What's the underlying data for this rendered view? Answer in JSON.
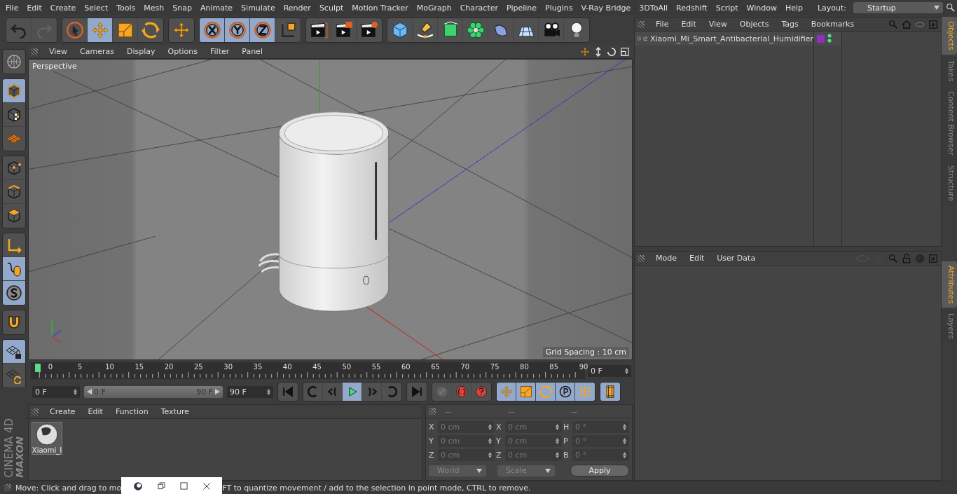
{
  "menu_bar": {
    "items": [
      "File",
      "Edit",
      "Create",
      "Select",
      "Tools",
      "Mesh",
      "Snap",
      "Animate",
      "Simulate",
      "Render",
      "Sculpt",
      "Motion Tracker",
      "MoGraph",
      "Character",
      "Pipeline",
      "Plugins",
      "V-Ray Bridge",
      "3DToAll",
      "Redshift",
      "Script",
      "Window",
      "Help"
    ],
    "layout_label": "Layout:",
    "layout_value": "Startup"
  },
  "main_toolbar": [
    {
      "tools": [
        {
          "selected": false,
          "disabled": false
        },
        {
          "selected": false,
          "disabled": true
        }
      ]
    },
    {
      "tools": [
        {
          "selected": false,
          "disabled": false
        },
        {
          "selected": true,
          "disabled": false
        },
        {
          "selected": false,
          "disabled": false
        },
        {
          "selected": false,
          "disabled": false
        }
      ]
    },
    {
      "tools": [
        {
          "selected": false,
          "disabled": false
        }
      ]
    },
    {
      "tools": [
        {
          "selected": true,
          "disabled": false
        },
        {
          "selected": true,
          "disabled": false
        },
        {
          "selected": true,
          "disabled": false
        },
        {
          "selected": false,
          "disabled": false
        }
      ]
    },
    {
      "tools": [
        {
          "selected": false,
          "disabled": false
        },
        {
          "selected": false,
          "disabled": false
        },
        {
          "selected": false,
          "disabled": false
        }
      ]
    },
    {
      "tools": [
        {
          "selected": false,
          "disabled": false
        },
        {
          "selected": false,
          "disabled": false
        },
        {
          "selected": false,
          "disabled": false
        },
        {
          "selected": false,
          "disabled": false
        },
        {
          "selected": false,
          "disabled": false
        },
        {
          "selected": false,
          "disabled": false
        },
        {
          "selected": false,
          "disabled": false
        },
        {
          "selected": false,
          "disabled": false
        }
      ]
    }
  ],
  "left_toolbar": [
    {
      "tools": [
        {
          "selected": false
        }
      ]
    },
    {
      "tools": [
        {
          "selected": true
        },
        {
          "selected": false
        },
        {
          "selected": false
        }
      ]
    },
    {
      "tools": [
        {
          "selected": false
        },
        {
          "selected": false
        },
        {
          "selected": false
        }
      ]
    },
    {
      "tools": [
        {
          "selected": false
        },
        {
          "selected": true
        },
        {
          "selected": true
        }
      ]
    },
    {
      "tools": [
        {
          "selected": false
        }
      ]
    },
    {
      "tools": [
        {
          "selected": true
        },
        {
          "selected": false
        }
      ]
    }
  ],
  "logo": {
    "brand": "MAXON",
    "product": "CINEMA 4D"
  },
  "viewport": {
    "menu": [
      "View",
      "Cameras",
      "Display",
      "Options",
      "Filter",
      "Panel"
    ],
    "camera": "Perspective",
    "grid_spacing": "Grid Spacing : 10 cm"
  },
  "timeline": {
    "labels": [
      "0",
      "5",
      "10",
      "15",
      "20",
      "25",
      "30",
      "35",
      "40",
      "45",
      "50",
      "55",
      "60",
      "65",
      "70",
      "75",
      "80",
      "85",
      "90"
    ],
    "current_frame": "0 F"
  },
  "playback": {
    "start": "0 F",
    "range_start": "0 F",
    "range_end": "90 F",
    "range_fill": {
      "level": 1
    },
    "end": "90 F",
    "transport": [
      {
        "selected": false
      },
      {
        "selected": false
      },
      {
        "selected": false
      },
      {
        "selected": true
      },
      {
        "selected": false
      },
      {
        "selected": false
      },
      {
        "selected": false
      }
    ],
    "record": [
      {
        "disabled": true
      },
      {
        "disabled": false
      },
      {
        "disabled": false
      }
    ],
    "key_modes": [
      {
        "selected": true
      },
      {
        "selected": true
      },
      {
        "selected": true
      },
      {
        "selected": true
      },
      {
        "selected": true
      }
    ],
    "timeline_button": {
      "selected": true
    }
  },
  "material_manager": {
    "menu": [
      "Create",
      "Edit",
      "Function",
      "Texture"
    ],
    "materials": [
      {
        "name": "Xiaomi_I"
      }
    ]
  },
  "coordinates": {
    "headers": [
      "--",
      "--",
      "--"
    ],
    "columns": [
      {
        "fields": [
          {
            "axis": "X",
            "value": "0 cm"
          },
          {
            "axis": "Y",
            "value": "0 cm"
          },
          {
            "axis": "Z",
            "value": "0 cm"
          }
        ]
      },
      {
        "fields": [
          {
            "axis": "X",
            "value": "0 cm"
          },
          {
            "axis": "Y",
            "value": "0 cm"
          },
          {
            "axis": "Z",
            "value": "0 cm"
          }
        ]
      },
      {
        "fields": [
          {
            "axis": "H",
            "value": "0 °"
          },
          {
            "axis": "P",
            "value": "0 °"
          },
          {
            "axis": "B",
            "value": "0 °"
          }
        ]
      }
    ],
    "dropdowns": [
      "World",
      "Scale"
    ],
    "apply": "Apply"
  },
  "objects_panel": {
    "menu": [
      "File",
      "Edit",
      "View",
      "Objects",
      "Tags",
      "Bookmarks"
    ],
    "objects": [
      {
        "name": "Xiaomi_Mi_Smart_Antibacterial_Humidifier",
        "color": "#8e2fc0",
        "expanded": false
      }
    ]
  },
  "side_tabs_top": [
    {
      "label": "Objects",
      "selected": true
    },
    {
      "label": "Takes",
      "selected": false
    },
    {
      "label": "Content Browser",
      "selected": false
    },
    {
      "label": "Structure",
      "selected": false
    }
  ],
  "attributes_panel": {
    "menu": [
      "Mode",
      "Edit",
      "User Data"
    ]
  },
  "side_tabs_bottom": [
    {
      "label": "Attributes",
      "selected": true
    },
    {
      "label": "Layers",
      "selected": false
    }
  ],
  "status_bar": {
    "parts": [
      "Move: Click and drag to mo",
      "FT to quantize movement / add to the selection in point mode, CTRL to remove."
    ]
  }
}
